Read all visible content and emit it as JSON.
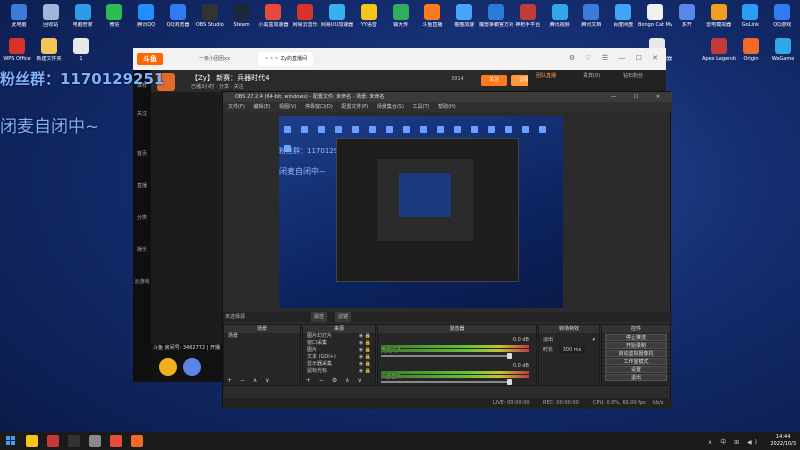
{
  "desktop_icons": [
    {
      "label": "此电脑",
      "color": "#3d7bd8"
    },
    {
      "label": "回收站",
      "color": "#9fb8d8"
    },
    {
      "label": "电脑管家",
      "color": "#2c9be8"
    },
    {
      "label": "微信",
      "color": "#2bbd53"
    },
    {
      "label": "腾讯QQ",
      "color": "#1e90ff"
    },
    {
      "label": "QQ浏览器",
      "color": "#2f7bf0"
    },
    {
      "label": "OBS Studio",
      "color": "#333333"
    },
    {
      "label": "Steam",
      "color": "#1b2838"
    },
    {
      "label": "小黑盒加速器",
      "color": "#e64b3c"
    },
    {
      "label": "网易云音乐",
      "color": "#d6332b"
    },
    {
      "label": "网易UU加速器",
      "color": "#35b0f0"
    },
    {
      "label": "YY语音",
      "color": "#f5c51a"
    },
    {
      "label": "输大传",
      "color": "#2fae5b"
    },
    {
      "label": "斗鱼直播",
      "color": "#ff7a1a"
    },
    {
      "label": "猫猫加速",
      "color": "#48a4ff"
    },
    {
      "label": "魔兽争霸官方对战平台",
      "color": "#2a7bd8"
    },
    {
      "label": "神枪手平台",
      "color": "#c23a3a"
    },
    {
      "label": "腾讯视频",
      "color": "#2fa7e8"
    },
    {
      "label": "腾讯文档",
      "color": "#3d7bd8"
    },
    {
      "label": "百度网盘",
      "color": "#3fa5f5"
    },
    {
      "label": "Bongo Cat Mver",
      "color": "#f0f0f0"
    },
    {
      "label": "多开",
      "color": "#5a86e8"
    },
    {
      "label": "雷电模拟器",
      "color": "#f0a020"
    },
    {
      "label": "GoLink",
      "color": "#2a9df4"
    },
    {
      "label": "QQ游戏",
      "color": "#2f7bf0"
    },
    {
      "label": "WPS Office",
      "color": "#d6332b"
    },
    {
      "label": "新建文件夹",
      "color": "#f2c45a"
    },
    {
      "label": "1",
      "color": "#e8e8e8"
    },
    {
      "label": "小黑盒加速器",
      "color": "#e8e8e8"
    },
    {
      "label": "Apex Legends",
      "color": "#c23a3a"
    },
    {
      "label": "Origin",
      "color": "#f26a2a"
    },
    {
      "label": "WeGame",
      "color": "#2fa7e8"
    }
  ],
  "overlay": {
    "fans_text": "粉丝群：1170129251",
    "mute_text": "闭麦自闭中~"
  },
  "client": {
    "logo": "斗鱼",
    "tabs": [
      "一条小团团xx",
      "丶丶丶 Zy的直播间"
    ],
    "room_title": "【Zy】 新赛：兵器时代4",
    "room_sub": "已播3小时 · 分享 · 关注",
    "follow_label": "关注",
    "follow_label2": "订阅",
    "follow_count": "3914",
    "right_tabs": [
      "团队直播",
      "贵宾(0)",
      "钻石粉丝"
    ],
    "side_items": [
      "推荐",
      "关注",
      "首页",
      "直播",
      "分类",
      "娱乐",
      "云游戏"
    ],
    "bottom_info": "斗鱼 房间号: 3462772 | 开播"
  },
  "obs": {
    "title": "OBS 27.2.4 (64-bit, windows) - 配置文件: 未命名 - 场景: 未命名",
    "menu": [
      "文件(F)",
      "编辑(E)",
      "视图(V)",
      "停靠窗口(D)",
      "配置文件(P)",
      "场景集合(S)",
      "工具(T)",
      "帮助(H)"
    ],
    "status_label": "未选择源",
    "status_buttons": [
      "属性",
      "滤镜"
    ],
    "preview_fans": "粉丝群：1170129251",
    "preview_mute": "闭麦自闭中~",
    "docks": {
      "scenes": {
        "title": "场景",
        "items": [
          "场景"
        ]
      },
      "sources": {
        "title": "来源",
        "items": [
          "图片幻灯片",
          "窗口采集",
          "图片",
          "文本 (GDI+)",
          "显示器采集",
          "鼠标光标"
        ]
      },
      "mixer": {
        "title": "混音器",
        "tracks": [
          {
            "name": "麦克风/Aux",
            "db": "0.0 dB"
          },
          {
            "name": "桌面音频",
            "db": "0.0 dB"
          }
        ]
      },
      "transitions": {
        "title": "转场特效",
        "type": "淡出",
        "duration_label": "时长",
        "duration": "300 ms"
      },
      "controls": {
        "title": "控件",
        "buttons": [
          "停止推流",
          "开始录制",
          "启动虚拟摄像机",
          "工作室模式",
          "设置",
          "退出"
        ]
      }
    },
    "footer": {
      "live": "LIVE: 00:00:00",
      "rec": "REC: 00:00:00",
      "cpu": "CPU: 0.0%, 60.00 fps",
      "kbps": "kb/s"
    }
  },
  "taskbar": {
    "apps": [
      {
        "color": "#f5c51a"
      },
      {
        "color": "#c23a3a"
      },
      {
        "color": "#333333"
      },
      {
        "color": "#8a8a8a"
      },
      {
        "color": "#e64b3c"
      },
      {
        "color": "#f26a2a"
      }
    ],
    "tray": "∧ 中 ⊞ ◀)",
    "time": "14:44",
    "date": "2022/10/3"
  }
}
